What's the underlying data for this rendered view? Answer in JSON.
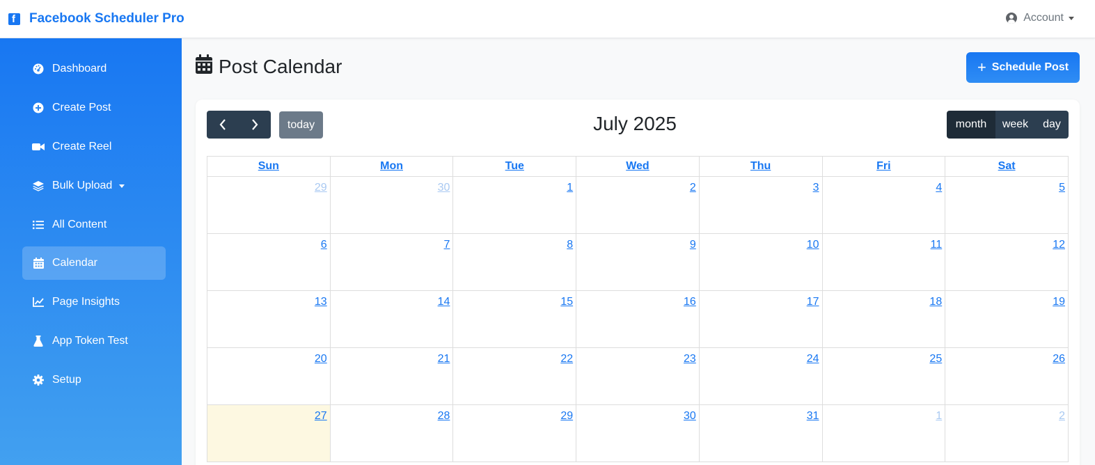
{
  "app": {
    "title": "Facebook Scheduler Pro",
    "account_label": "Account"
  },
  "sidebar": {
    "items": [
      {
        "label": "Dashboard",
        "icon": "dashboard-icon"
      },
      {
        "label": "Create Post",
        "icon": "plus-circle-icon"
      },
      {
        "label": "Create Reel",
        "icon": "video-icon"
      },
      {
        "label": "Bulk Upload",
        "icon": "layers-icon"
      },
      {
        "label": "All Content",
        "icon": "list-icon"
      },
      {
        "label": "Calendar",
        "icon": "calendar-icon",
        "active": true
      },
      {
        "label": "Page Insights",
        "icon": "chart-line-icon"
      },
      {
        "label": "App Token Test",
        "icon": "flask-icon"
      },
      {
        "label": "Setup",
        "icon": "gear-icon"
      }
    ]
  },
  "main": {
    "page_title": "Post Calendar",
    "schedule_button": "Schedule Post"
  },
  "calendar": {
    "title": "July 2025",
    "today_label": "today",
    "views": {
      "month": "month",
      "week": "week",
      "day": "day"
    },
    "active_view": "month",
    "weekdays": [
      "Sun",
      "Mon",
      "Tue",
      "Wed",
      "Thu",
      "Fri",
      "Sat"
    ],
    "weeks": [
      [
        {
          "d": "29",
          "other": true
        },
        {
          "d": "30",
          "other": true
        },
        {
          "d": "1"
        },
        {
          "d": "2"
        },
        {
          "d": "3"
        },
        {
          "d": "4"
        },
        {
          "d": "5"
        }
      ],
      [
        {
          "d": "6"
        },
        {
          "d": "7"
        },
        {
          "d": "8"
        },
        {
          "d": "9"
        },
        {
          "d": "10"
        },
        {
          "d": "11"
        },
        {
          "d": "12"
        }
      ],
      [
        {
          "d": "13"
        },
        {
          "d": "14"
        },
        {
          "d": "15"
        },
        {
          "d": "16"
        },
        {
          "d": "17"
        },
        {
          "d": "18"
        },
        {
          "d": "19"
        }
      ],
      [
        {
          "d": "20"
        },
        {
          "d": "21"
        },
        {
          "d": "22"
        },
        {
          "d": "23"
        },
        {
          "d": "24"
        },
        {
          "d": "25"
        },
        {
          "d": "26"
        }
      ],
      [
        {
          "d": "27",
          "today": true
        },
        {
          "d": "28"
        },
        {
          "d": "29"
        },
        {
          "d": "30"
        },
        {
          "d": "31"
        },
        {
          "d": "1",
          "other": true
        },
        {
          "d": "2",
          "other": true
        }
      ]
    ]
  },
  "colors": {
    "brand": "#1877f2",
    "dark_button": "#2c3e50",
    "today_highlight": "#fdf8e1"
  }
}
